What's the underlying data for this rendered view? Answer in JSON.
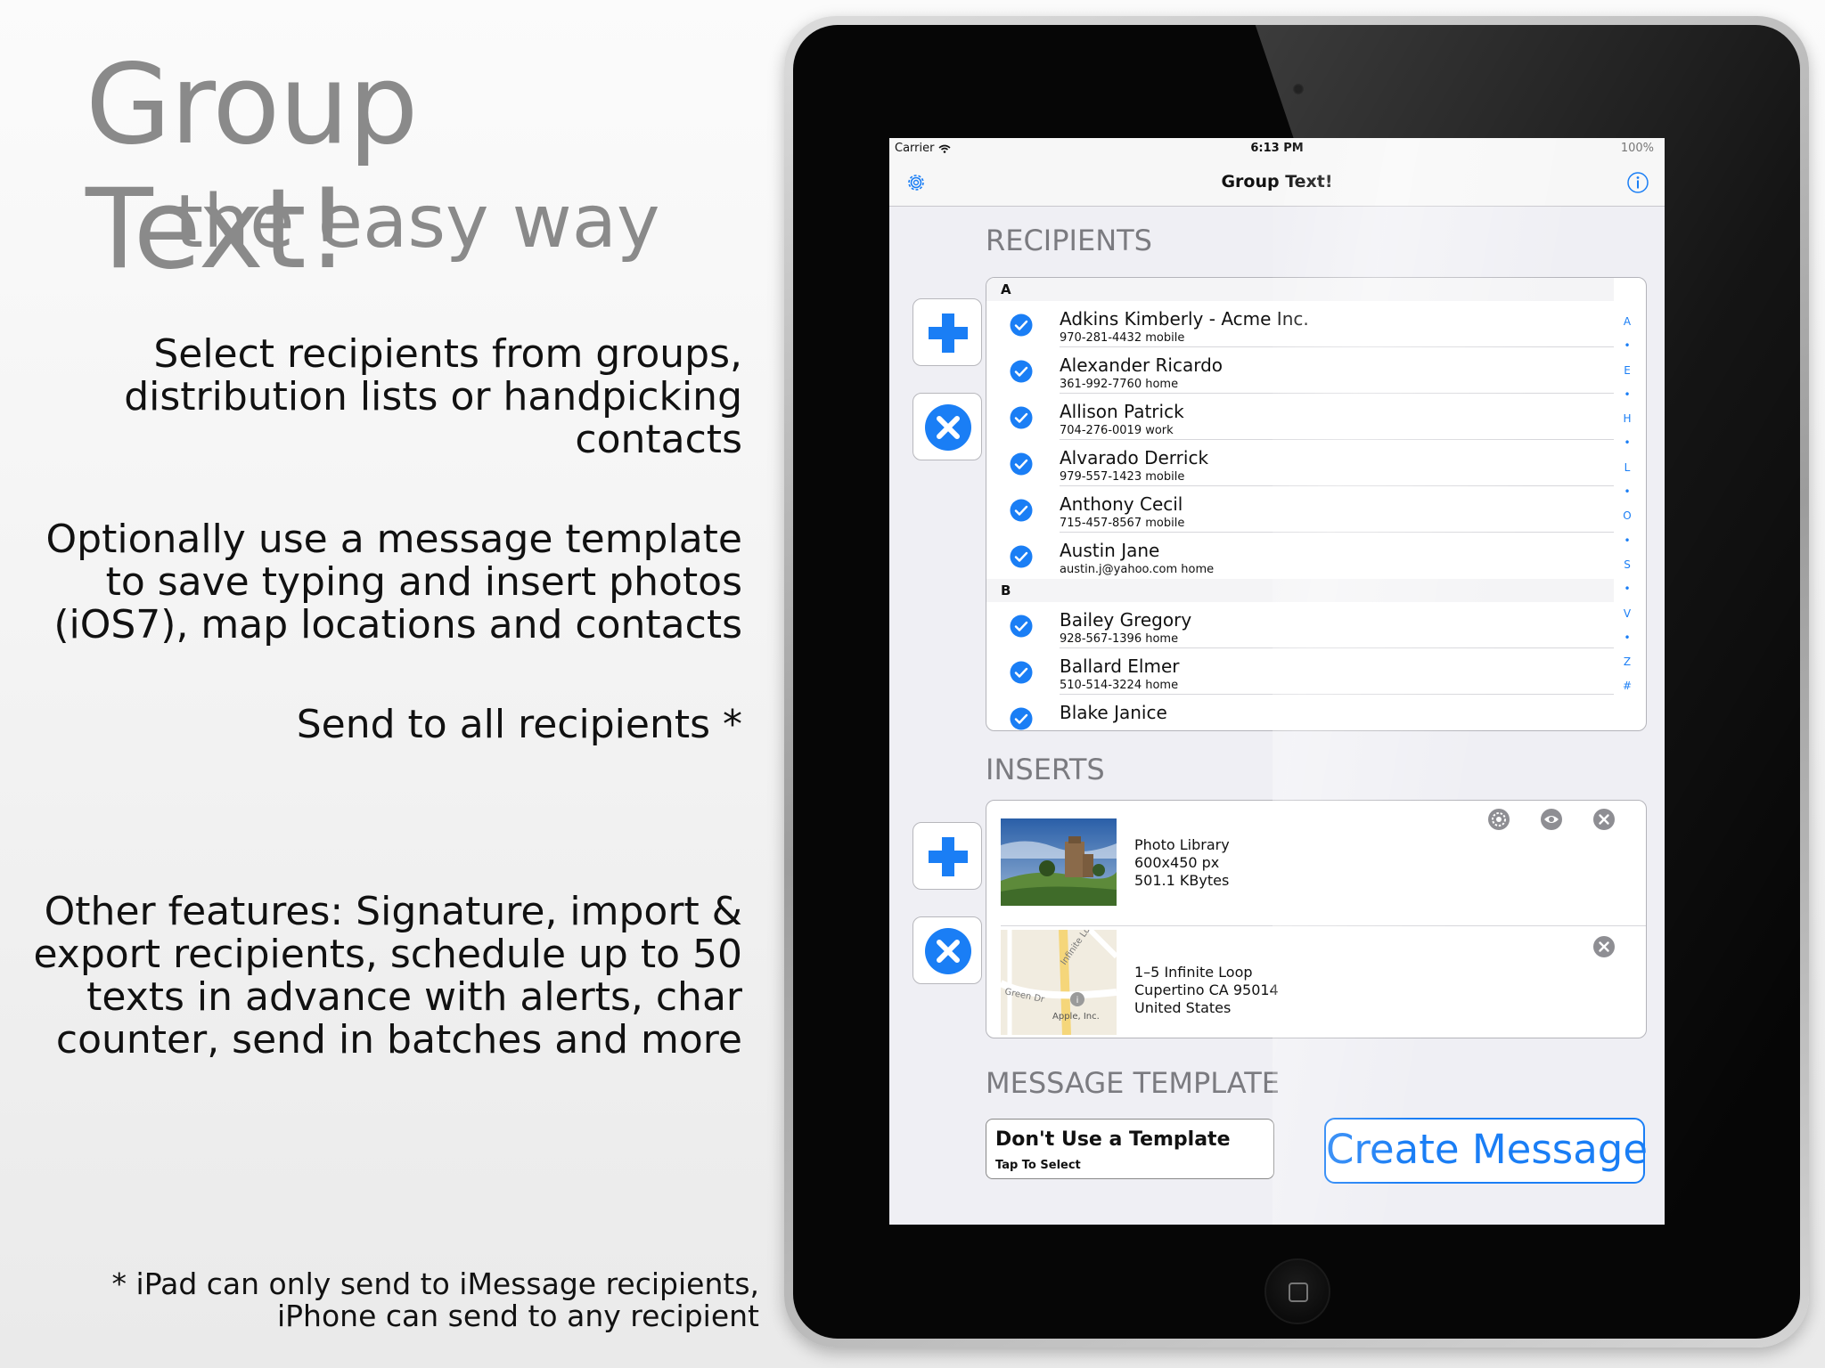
{
  "promo": {
    "title": "Group Text!",
    "subtitle": "the easy way",
    "features": [
      [
        "Select recipients from groups,",
        "distribution lists or handpicking",
        "contacts"
      ],
      [
        "Optionally use a message template",
        "to save typing and insert photos",
        "(iOS7), map locations and contacts"
      ],
      [
        "Send to all recipients *"
      ],
      [
        "Other features: Signature, import &",
        "export recipients, schedule up to 50",
        "texts in advance with alerts, char",
        "counter, send in batches and more"
      ]
    ],
    "footnote": [
      "* iPad can only send to iMessage recipients,",
      "iPhone can send to any recipient"
    ]
  },
  "status_bar": {
    "carrier": "Carrier",
    "time": "6:13 PM",
    "battery": "100%"
  },
  "nav": {
    "title": "Group Text!",
    "left_icon": "gear-icon",
    "right_icon": "info-icon"
  },
  "recipients": {
    "heading": "RECIPIENTS",
    "sections": [
      {
        "letter": "A",
        "contacts": [
          {
            "name": "Adkins Kimberly - Acme Inc.",
            "detail": "970-281-4432 mobile",
            "checked": true
          },
          {
            "name": "Alexander Ricardo",
            "detail": "361-992-7760 home",
            "checked": true
          },
          {
            "name": "Allison Patrick",
            "detail": "704-276-0019 work",
            "checked": true
          },
          {
            "name": "Alvarado Derrick",
            "detail": "979-557-1423 mobile",
            "checked": true
          },
          {
            "name": "Anthony Cecil",
            "detail": "715-457-8567 mobile",
            "checked": true
          },
          {
            "name": "Austin Jane",
            "detail": "austin.j@yahoo.com home",
            "checked": true
          }
        ]
      },
      {
        "letter": "B",
        "contacts": [
          {
            "name": "Bailey Gregory",
            "detail": "928-567-1396 home",
            "checked": true
          },
          {
            "name": "Ballard Elmer",
            "detail": "510-514-3224 home",
            "checked": true
          },
          {
            "name": "Blake Janice",
            "detail": "",
            "checked": true
          }
        ]
      }
    ],
    "index": [
      "A",
      "•",
      "E",
      "•",
      "H",
      "•",
      "L",
      "•",
      "O",
      "•",
      "S",
      "•",
      "V",
      "•",
      "Z",
      "#"
    ]
  },
  "inserts": {
    "heading": "INSERTS",
    "items": [
      {
        "kind": "photo",
        "lines": [
          "Photo Library",
          "600x450 px",
          "501.1 KBytes"
        ],
        "actions": [
          "gear-icon",
          "eye-icon",
          "close-icon"
        ]
      },
      {
        "kind": "map",
        "map_labels": [
          "Infinite Loop",
          "Green Dr",
          "Apple, Inc."
        ],
        "lines": [
          "1–5 Infinite Loop",
          "Cupertino CA 95014",
          "United States"
        ],
        "actions": [
          "close-icon"
        ]
      }
    ]
  },
  "template": {
    "heading": "MESSAGE TEMPLATE",
    "title": "Don't Use a Template",
    "subtitle": "Tap To Select"
  },
  "create_button": "Create Message",
  "colors": {
    "accent": "#1a7ef5",
    "heading_gray": "#7b7b80",
    "promo_gray": "#8a8a8a"
  }
}
